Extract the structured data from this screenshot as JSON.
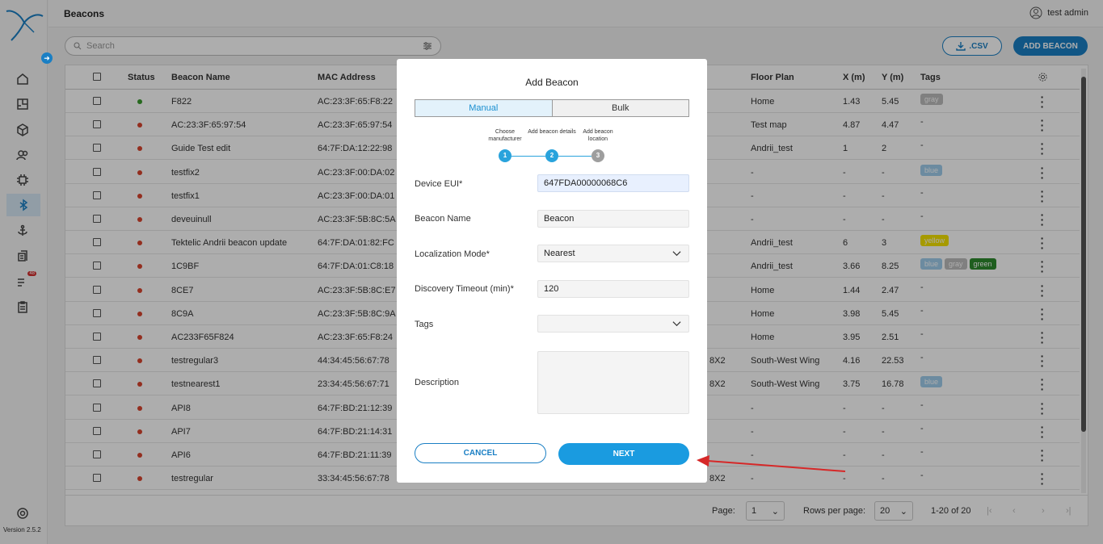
{
  "app": {
    "page_title": "Beacons",
    "user_name": "test admin",
    "version": "Version 2.5.2",
    "nav_badge": "48"
  },
  "toolbar": {
    "search_placeholder": "Search",
    "csv_label": ".CSV",
    "add_label": "ADD BEACON"
  },
  "table": {
    "headers": {
      "status": "Status",
      "name": "Beacon Name",
      "mac": "MAC Address",
      "floor": "Floor Plan",
      "x": "X (m)",
      "y": "Y (m)",
      "tags": "Tags"
    },
    "rows": [
      {
        "status": "green",
        "name": "F822",
        "mac": "AC:23:3F:65:F8:22",
        "zone": "",
        "floor": "Home",
        "x": "1.43",
        "y": "5.45",
        "tags": [
          {
            "t": "gray",
            "c": "#bdbdbd"
          }
        ]
      },
      {
        "status": "red",
        "name": "AC:23:3F:65:97:54",
        "mac": "AC:23:3F:65:97:54",
        "zone": "",
        "floor": "Test map",
        "x": "4.87",
        "y": "4.47",
        "tags": [],
        "tagtext": "-"
      },
      {
        "status": "red",
        "name": "Guide Test edit",
        "mac": "64:7F:DA:12:22:98",
        "zone": "",
        "floor": "Andrii_test",
        "x": "1",
        "y": "2",
        "tags": [],
        "tagtext": "-"
      },
      {
        "status": "red",
        "name": "testfix2",
        "mac": "AC:23:3F:00:DA:02",
        "zone": "",
        "floor": "-",
        "x": "-",
        "y": "-",
        "tags": [
          {
            "t": "blue",
            "c": "#9fcdec"
          }
        ]
      },
      {
        "status": "red",
        "name": "testfix1",
        "mac": "AC:23:3F:00:DA:01",
        "zone": "",
        "floor": "-",
        "x": "-",
        "y": "-",
        "tags": [],
        "tagtext": "-"
      },
      {
        "status": "red",
        "name": "deveuinull",
        "mac": "AC:23:3F:5B:8C:5A",
        "zone": "",
        "floor": "-",
        "x": "-",
        "y": "-",
        "tags": [],
        "tagtext": "-"
      },
      {
        "status": "red",
        "name": "Tektelic Andrii beacon update",
        "mac": "64:7F:DA:01:82:FC",
        "zone": "",
        "floor": "Andrii_test",
        "x": "6",
        "y": "3",
        "tags": [
          {
            "t": "yellow",
            "c": "#f5e400"
          }
        ]
      },
      {
        "status": "red",
        "name": "1C9BF",
        "mac": "64:7F:DA:01:C8:18",
        "zone": "",
        "floor": "Andrii_test",
        "x": "3.66",
        "y": "8.25",
        "tags": [
          {
            "t": "blue",
            "c": "#9fcdec"
          },
          {
            "t": "gray",
            "c": "#bdbdbd"
          },
          {
            "t": "green",
            "c": "#2e8b2e"
          }
        ]
      },
      {
        "status": "red",
        "name": "8CE7",
        "mac": "AC:23:3F:5B:8C:E7",
        "zone": "",
        "floor": "Home",
        "x": "1.44",
        "y": "2.47",
        "tags": [],
        "tagtext": "-"
      },
      {
        "status": "red",
        "name": "8C9A",
        "mac": "AC:23:3F:5B:8C:9A",
        "zone": "",
        "floor": "Home",
        "x": "3.98",
        "y": "5.45",
        "tags": [],
        "tagtext": "-"
      },
      {
        "status": "red",
        "name": "AC233F65F824",
        "mac": "AC:23:3F:65:F8:24",
        "zone": "",
        "floor": "Home",
        "x": "3.95",
        "y": "2.51",
        "tags": [],
        "tagtext": "-"
      },
      {
        "status": "red",
        "name": "testregular3",
        "mac": "44:34:45:56:67:78",
        "zone": "8X2",
        "floor": "South-West Wing",
        "x": "4.16",
        "y": "22.53",
        "tags": [],
        "tagtext": "-"
      },
      {
        "status": "red",
        "name": "testnearest1",
        "mac": "23:34:45:56:67:71",
        "zone": "8X2",
        "floor": "South-West Wing",
        "x": "3.75",
        "y": "16.78",
        "tags": [
          {
            "t": "blue",
            "c": "#9fcdec"
          }
        ]
      },
      {
        "status": "red",
        "name": "API8",
        "mac": "64:7F:BD:21:12:39",
        "zone": "",
        "floor": "-",
        "x": "-",
        "y": "-",
        "tags": [],
        "tagtext": "-"
      },
      {
        "status": "red",
        "name": "API7",
        "mac": "64:7F:BD:21:14:31",
        "zone": "",
        "floor": "-",
        "x": "-",
        "y": "-",
        "tags": [],
        "tagtext": "-"
      },
      {
        "status": "red",
        "name": "API6",
        "mac": "64:7F:BD:21:11:39",
        "zone": "",
        "floor": "-",
        "x": "-",
        "y": "-",
        "tags": [],
        "tagtext": "-"
      },
      {
        "status": "red",
        "name": "testregular",
        "mac": "33:34:45:56:67:78",
        "zone": "8X2",
        "floor": "-",
        "x": "-",
        "y": "-",
        "tags": [],
        "tagtext": "-"
      }
    ]
  },
  "pager": {
    "page_label": "Page:",
    "page_value": "1",
    "rpp_label": "Rows per page:",
    "rpp_value": "20",
    "range": "1-20 of 20"
  },
  "modal": {
    "title": "Add Beacon",
    "tab_manual": "Manual",
    "tab_bulk": "Bulk",
    "steps": [
      {
        "n": "1",
        "label": "Choose manufacturer",
        "state": "done"
      },
      {
        "n": "2",
        "label": "Add beacon details",
        "state": "active"
      },
      {
        "n": "3",
        "label": "Add beacon location",
        "state": "todo"
      }
    ],
    "fields": {
      "eui_label": "Device EUI*",
      "eui_value": "647FDA00000068C6",
      "name_label": "Beacon Name",
      "name_value": "Beacon",
      "mode_label": "Localization Mode*",
      "mode_value": "Nearest",
      "timeout_label": "Discovery Timeout (min)*",
      "timeout_value": "120",
      "tags_label": "Tags",
      "tags_value": "",
      "desc_label": "Description",
      "desc_value": ""
    },
    "cancel_label": "CANCEL",
    "next_label": "NEXT"
  },
  "colors": {
    "accent": "#1a7fc4",
    "status_green": "#3a9b2e",
    "status_red": "#d9452f",
    "annotation_arrow": "#d62828"
  }
}
